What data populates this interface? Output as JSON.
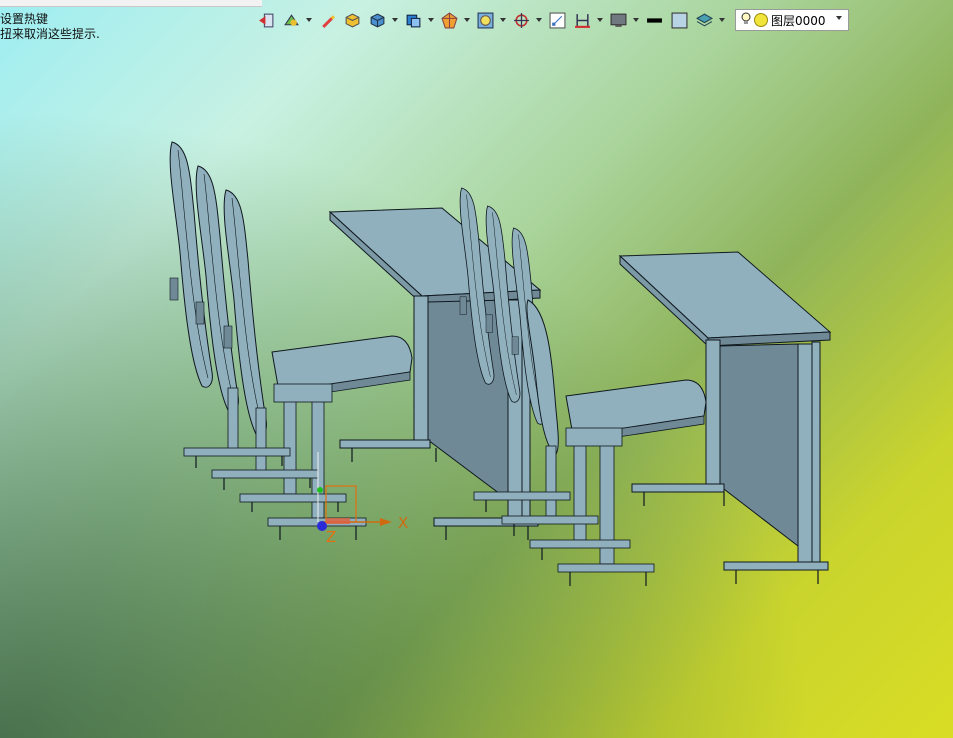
{
  "hints": {
    "line1": "设置热键",
    "line2": "扭来取消这些提示."
  },
  "toolbar": {
    "buttons": [
      {
        "name": "exit-icon",
        "drop": false
      },
      {
        "name": "sketch-icon",
        "drop": true
      },
      {
        "name": "pencil-icon",
        "drop": false
      },
      {
        "name": "box-solid-icon",
        "drop": false
      },
      {
        "name": "cube-icon",
        "drop": true
      },
      {
        "name": "face-icon",
        "drop": true
      },
      {
        "name": "polygon-icon",
        "drop": true
      },
      {
        "name": "ring-icon",
        "drop": true
      },
      {
        "name": "target-icon",
        "drop": true
      },
      {
        "name": "grid-icon",
        "drop": false
      },
      {
        "name": "dimension-icon",
        "drop": true
      },
      {
        "name": "monitor-icon",
        "drop": true
      },
      {
        "name": "line-color-icon",
        "drop": false
      },
      {
        "name": "fill-color-icon",
        "drop": false
      },
      {
        "name": "layers-icon",
        "drop": true
      }
    ],
    "layer_label": "图层0000"
  },
  "axis": {
    "x_label": "X",
    "z_label": "Z"
  },
  "colors": {
    "furniture_fill": "#8fb0bc",
    "furniture_dark": "#6f8a96",
    "outline": "#101820",
    "axis_x": "#d06a10",
    "axis_z": "#e07010"
  }
}
